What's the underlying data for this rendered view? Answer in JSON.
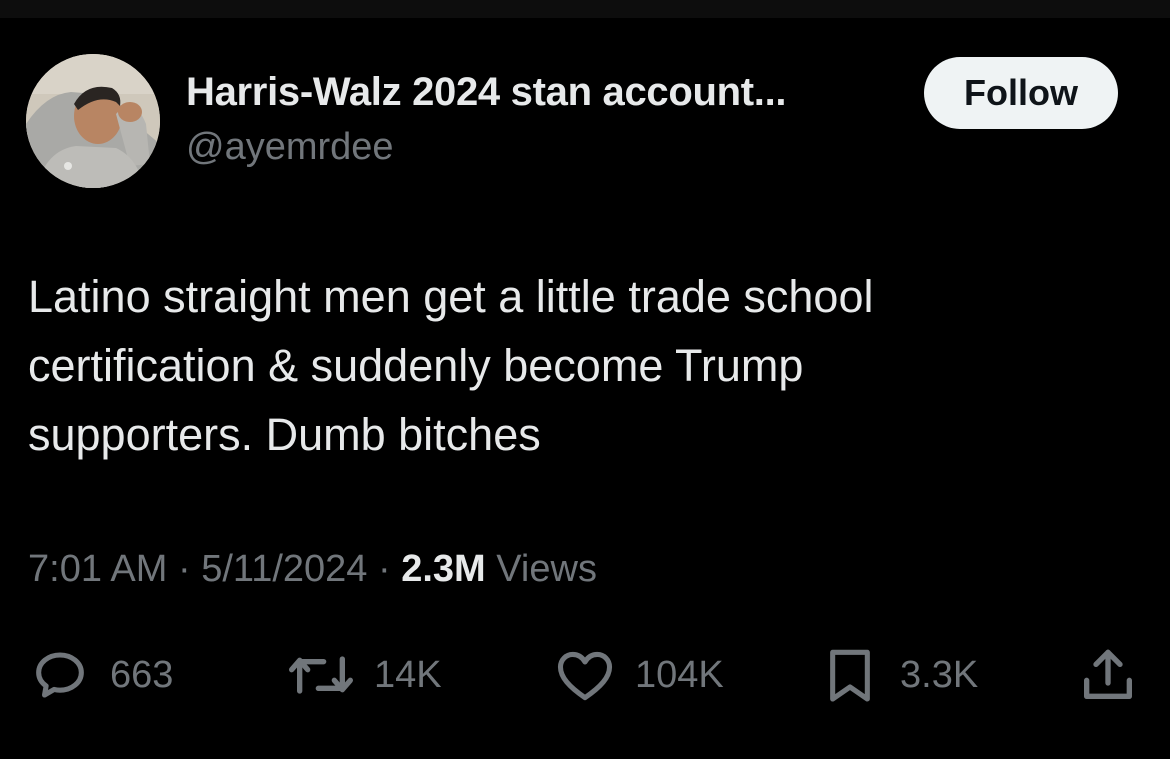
{
  "tweet": {
    "author": {
      "display_name": "Harris-Walz 2024 stan account...",
      "handle": "@ayemrdee"
    },
    "follow_label": "Follow",
    "text_lines": [
      "Latino straight men get a little trade school",
      "certification & suddenly become Trump",
      "supporters. Dumb bitches"
    ],
    "time": "7:01 AM",
    "separator": "·",
    "date": "5/11/2024",
    "views_count": "2.3M",
    "views_label": "Views"
  },
  "actions": {
    "reply": {
      "icon": "reply-icon",
      "count": "663"
    },
    "retweet": {
      "icon": "retweet-icon",
      "count": "14K"
    },
    "like": {
      "icon": "heart-icon",
      "count": "104K"
    },
    "bookmark": {
      "icon": "bookmark-icon",
      "count": "3.3K"
    },
    "share": {
      "icon": "share-icon"
    }
  },
  "colors": {
    "background": "#000000",
    "primary_text": "#e7e9ea",
    "secondary_text": "#71767b",
    "follow_button_bg": "#eff3f4",
    "follow_button_text": "#0f1419"
  }
}
